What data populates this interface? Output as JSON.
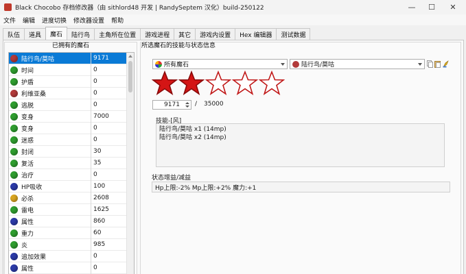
{
  "window": {
    "title": "Black Chocobo 存档修改器（由 sithlord48 开发 | RandySeptem 汉化）build-250122",
    "minimize_glyph": "—",
    "maximize_glyph": "☐",
    "close_glyph": "✕"
  },
  "menu": [
    "文件",
    "编辑",
    "进度切换",
    "修改器设置",
    "帮助"
  ],
  "tabs": [
    "队伍",
    "道具",
    "魔石",
    "陆行鸟",
    "主角所在位置",
    "游戏进程",
    "其它",
    "游戏内设置",
    "Hex 编辑器",
    "测试数据"
  ],
  "active_tab_index": 2,
  "materia_list": {
    "title": "已拥有的魔石",
    "selected_index": 0,
    "rows": [
      {
        "name": "陆行鸟/莫咕",
        "value": "9171",
        "color": "#b23a3a"
      },
      {
        "name": "时间",
        "value": "0",
        "color": "#2f9e2f"
      },
      {
        "name": "护盾",
        "value": "0",
        "color": "#2f9e2f"
      },
      {
        "name": "利维亚桑",
        "value": "0",
        "color": "#b23a3a"
      },
      {
        "name": "逃脱",
        "value": "0",
        "color": "#2f9e2f"
      },
      {
        "name": "变身",
        "value": "7000",
        "color": "#2f9e2f"
      },
      {
        "name": "变身",
        "value": "0",
        "color": "#2f9e2f"
      },
      {
        "name": "迷惑",
        "value": "0",
        "color": "#2f9e2f"
      },
      {
        "name": "封闭",
        "value": "30",
        "color": "#2f9e2f"
      },
      {
        "name": "复活",
        "value": "35",
        "color": "#2f9e2f"
      },
      {
        "name": "治疗",
        "value": "0",
        "color": "#2f9e2f"
      },
      {
        "name": "HP吸收",
        "value": "100",
        "color": "#2b3aa8"
      },
      {
        "name": "必杀",
        "value": "2608",
        "color": "#d9a520"
      },
      {
        "name": "雷电",
        "value": "1625",
        "color": "#2f9e2f"
      },
      {
        "name": "属性",
        "value": "860",
        "color": "#2b3aa8"
      },
      {
        "name": "重力",
        "value": "60",
        "color": "#2f9e2f"
      },
      {
        "name": "炎",
        "value": "985",
        "color": "#2f9e2f"
      },
      {
        "name": "追加效果",
        "value": "0",
        "color": "#2b3aa8"
      },
      {
        "name": "属性",
        "value": "0",
        "color": "#2b3aa8"
      }
    ]
  },
  "detail": {
    "title": "所选魔石的技能与状态信息",
    "filter_combo": "所有魔石",
    "materia_combo": "陆行鸟/莫咕",
    "stars_filled": 2,
    "stars_total": 5,
    "ap_value": "9171",
    "slash": "/",
    "ap_max": "35000",
    "skills_label": "技能-[风]",
    "skills": [
      "陆行鸟/莫咕 x1 (14mp)",
      "陆行鸟/莫咕 x2 (14mp)"
    ],
    "status_label": "状态增益/减益",
    "status_text": "Hp上限:-2% Mp上限:+2% 魔力:+1"
  }
}
